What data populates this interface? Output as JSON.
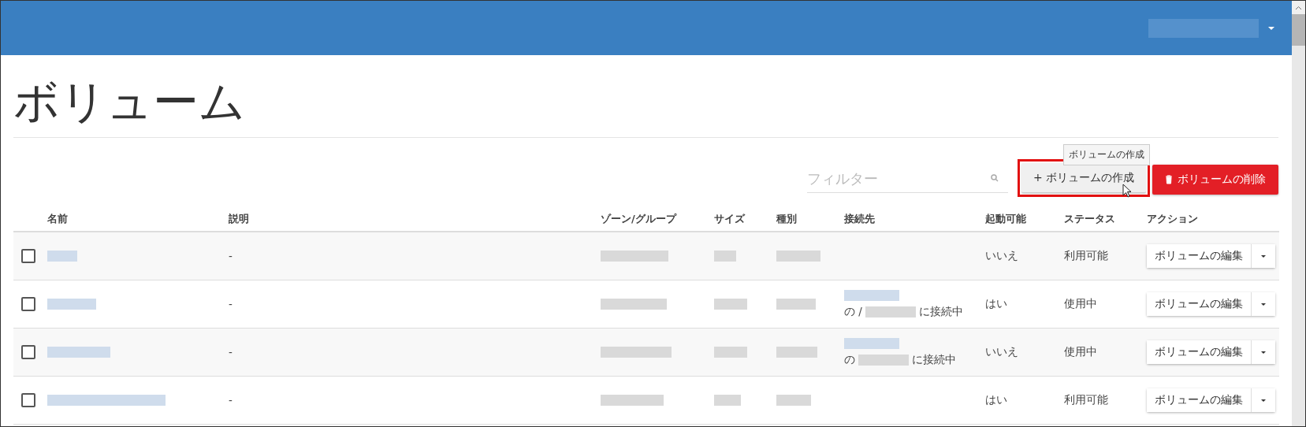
{
  "page_title": "ボリューム",
  "filter": {
    "placeholder": "フィルター"
  },
  "tooltip": "ボリュームの作成",
  "buttons": [
    {
      "kind": "create",
      "label": "+ ボリュームの作成",
      "highlighted": true
    },
    {
      "kind": "delete",
      "label": "ボリュームの削除",
      "highlighted": false
    }
  ],
  "table": {
    "columns": [
      "名前",
      "説明",
      "ゾーン/グループ",
      "サイズ",
      "種別",
      "接続先",
      "起動可能",
      "ステータス",
      "アクション"
    ],
    "rows": [
      {
        "checked": false,
        "description": "-",
        "bootable": "いいえ",
        "status": "利用可能",
        "action": "ボリュームの編集"
      },
      {
        "checked": false,
        "description": "-",
        "attached": {
          "prefix": "の /",
          "suffix": "に接続中"
        },
        "bootable": "はい",
        "status": "使用中",
        "action": "ボリュームの編集"
      },
      {
        "checked": false,
        "description": "-",
        "attached": {
          "prefix": "の",
          "suffix": "に接続中"
        },
        "bootable": "いいえ",
        "status": "使用中",
        "action": "ボリュームの編集"
      },
      {
        "checked": false,
        "description": "-",
        "bootable": "はい",
        "status": "利用可能",
        "action": "ボリュームの編集"
      }
    ]
  }
}
